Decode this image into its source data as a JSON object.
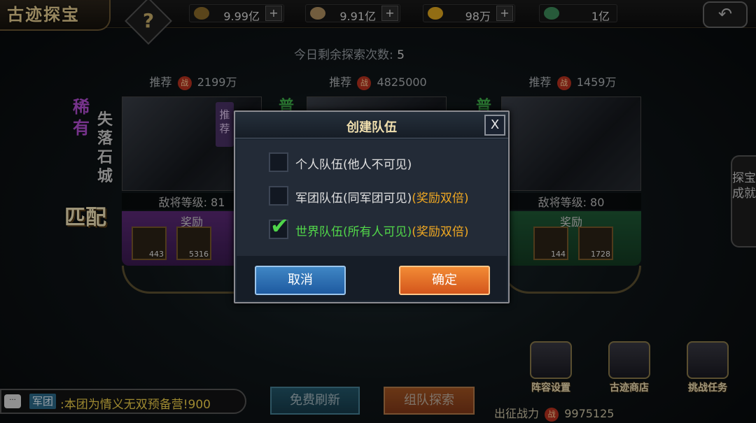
{
  "header": {
    "title": "古迹探宝",
    "help": "?",
    "resources": [
      {
        "icon": "wheat-icon",
        "value": "9.99亿",
        "plus": "+"
      },
      {
        "icon": "silver-coin-icon",
        "value": "9.91亿",
        "plus": "+"
      },
      {
        "icon": "gold-ingot-icon",
        "value": "98万",
        "plus": "+"
      },
      {
        "icon": "jade-icon",
        "value": "1亿"
      }
    ]
  },
  "remaining": {
    "label": "今日剩余探索次数:",
    "count": "5"
  },
  "cards": [
    {
      "recommend_label": "推荐",
      "power": "2199万",
      "rarity": "稀有",
      "name": "失落石城",
      "badge": "推荐",
      "level": "敌将等级: 81",
      "reward_label": "奖励",
      "rewards": [
        "443",
        "5316"
      ]
    },
    {
      "recommend_label": "推荐",
      "power": "4825000",
      "rarity": "普"
    },
    {
      "recommend_label": "推荐",
      "power": "1459万",
      "rarity": "普",
      "level": "敌将等级: 80",
      "reward_label": "奖励",
      "rewards": [
        "144",
        "1728"
      ]
    }
  ],
  "match_label": "匹配",
  "side_tab": "探宝成就",
  "bottom": {
    "chat_tag": "军团",
    "chat_msg": ":本团为情义无双预备营!900",
    "refresh": "免费刷新",
    "explore": "组队探索",
    "power_label": "出征战力",
    "power_value": "9975125",
    "functions": [
      "阵容设置",
      "古迹商店",
      "挑战任务"
    ]
  },
  "dialog": {
    "title": "创建队伍",
    "close": "X",
    "options": [
      {
        "main": "个人队伍(他人不可见)",
        "bonus": "",
        "checked": false
      },
      {
        "main": "军团队伍(同军团可见)",
        "bonus": "(奖励双倍)",
        "checked": false
      },
      {
        "main": "世界队伍(所有人可见)",
        "bonus": "(奖励双倍)",
        "checked": true
      }
    ],
    "cancel": "取消",
    "confirm": "确定"
  },
  "war_glyph": "战",
  "chat_bubble_glyph": "···",
  "check_glyph": "✔",
  "back_glyph": "↶",
  "colors": {
    "accent_green": "#52d84a",
    "bonus_orange": "#f0a822",
    "cancel_blue": "#2f72b4",
    "confirm_orange": "#e66e28"
  }
}
